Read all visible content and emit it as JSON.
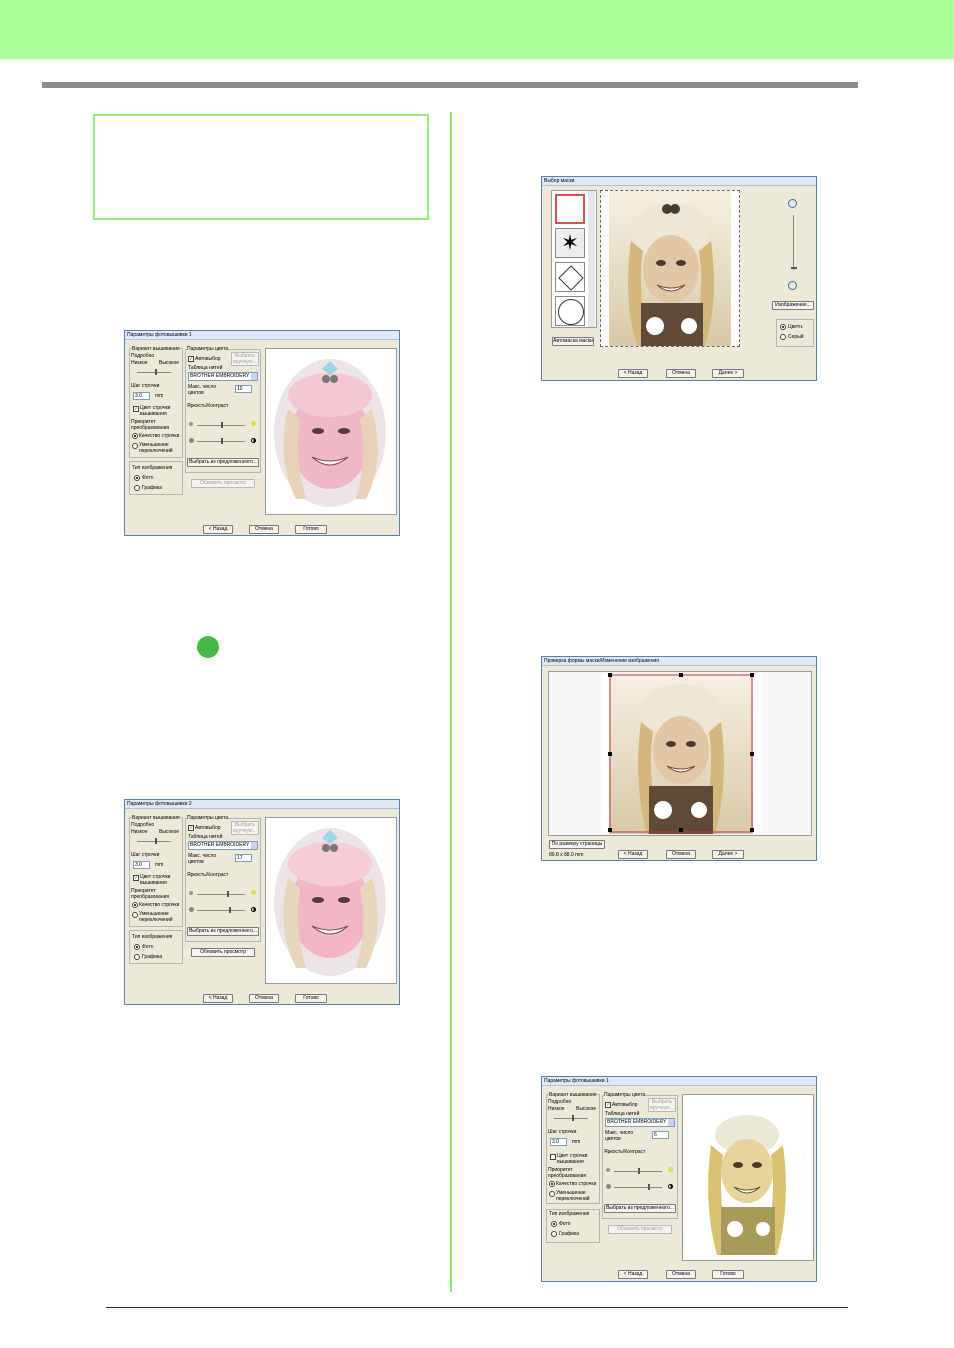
{
  "dialogs": {
    "photo_params": {
      "title": "Параметры фотовышивки 1",
      "grp_variant": "Вариант вышивания",
      "detail_label": "Подробно",
      "low_label": "Низкое",
      "high_label": "Высокое",
      "step_label": "Шаг строчки",
      "step_unit": "mm",
      "thread_color_label": "Цвет строчки вышивания",
      "priority_label": "Приоритет преобразования",
      "quality_label": "Качество строчки",
      "reduce_label": "Уменьшение переключений",
      "image_type_label": "Тип изображения",
      "photo_label": "Фото",
      "graphics_label": "Графика",
      "color_params_label": "Параметры цвета",
      "auto_select_label": "Автовыбор",
      "choose_label": "Выбрать вручную...",
      "table_label": "Таблица нитей",
      "table_value": "BROTHER EMBROIDERY",
      "max_colors_label": "Макс. число цветов",
      "brightness_label": "Яркость/Контраст",
      "choose_suggested_label": "Выбрать из предложенного...",
      "refresh_label": "Обновить просмотр",
      "back_label": "< Назад",
      "cancel_label": "Отмена",
      "done_label": "Готово"
    },
    "dlg1": {
      "step_value": "3.0",
      "max_colors": "10"
    },
    "dlg2": {
      "title": "Параметры фотовышивки 2",
      "step_value": "3.0",
      "max_colors": "17"
    },
    "dlg3": {
      "step_value": "3.0",
      "max_colors": "6"
    },
    "mask": {
      "title": "Выбор маски",
      "auto_mask_label": "Автомаска маски",
      "image_label": "Изображение...",
      "color_label": "Цветн.",
      "gray_label": "Серый",
      "back_label": "< Назад",
      "cancel_label": "Отмена",
      "next_label": "Далее >"
    },
    "check": {
      "title": "Проверка формы маски/Изменение изображения",
      "fit_page_label": "По размеру страницы",
      "size_readout": "89.8 x 88.0 mm",
      "back_label": "< Назад",
      "cancel_label": "Отмена",
      "next_label": "Далее >"
    }
  },
  "colors": {
    "header_band": "#aaff99",
    "divider": "#88ee66",
    "step_marker": "#44bb44",
    "dialog_bg": "#ece9d8"
  }
}
